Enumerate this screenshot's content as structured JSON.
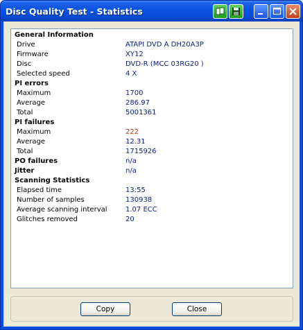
{
  "window": {
    "title": "Disc Quality Test - Statistics"
  },
  "sections": [
    {
      "header": "General Information",
      "rows": [
        {
          "label": "Drive",
          "value": "ATAPI   DVD A  DH20A3P"
        },
        {
          "label": "Firmware",
          "value": "XY12"
        },
        {
          "label": "Disc",
          "value": "DVD-R (MCC 03RG20  )"
        },
        {
          "label": "Selected speed",
          "value": "4 X"
        }
      ]
    },
    {
      "header": "PI errors",
      "rows": [
        {
          "label": "Maximum",
          "value": "1700"
        },
        {
          "label": "Average",
          "value": "286.97"
        },
        {
          "label": "Total",
          "value": "5001361"
        }
      ]
    },
    {
      "header": "PI failures",
      "rows": [
        {
          "label": "Maximum",
          "value": "222",
          "color": "#b23a1b"
        },
        {
          "label": "Average",
          "value": "12.31"
        },
        {
          "label": "Total",
          "value": "1715926"
        }
      ]
    },
    {
      "header": "PO failures",
      "value": "n/a"
    },
    {
      "header": "Jitter",
      "value": "n/a"
    },
    {
      "header": "Scanning Statistics",
      "rows": [
        {
          "label": "Elapsed time",
          "value": "13:55"
        },
        {
          "label": "Number of samples",
          "value": "130938"
        },
        {
          "label": "Average scanning interval",
          "value": "1.07 ECC"
        },
        {
          "label": "Glitches removed",
          "value": "20"
        }
      ]
    }
  ],
  "buttons": {
    "copy": "Copy",
    "close": "Close"
  },
  "icons": {
    "titlebar": [
      "copy-window-icon",
      "save-icon",
      "minimize-icon",
      "maximize-icon",
      "close-icon"
    ]
  }
}
